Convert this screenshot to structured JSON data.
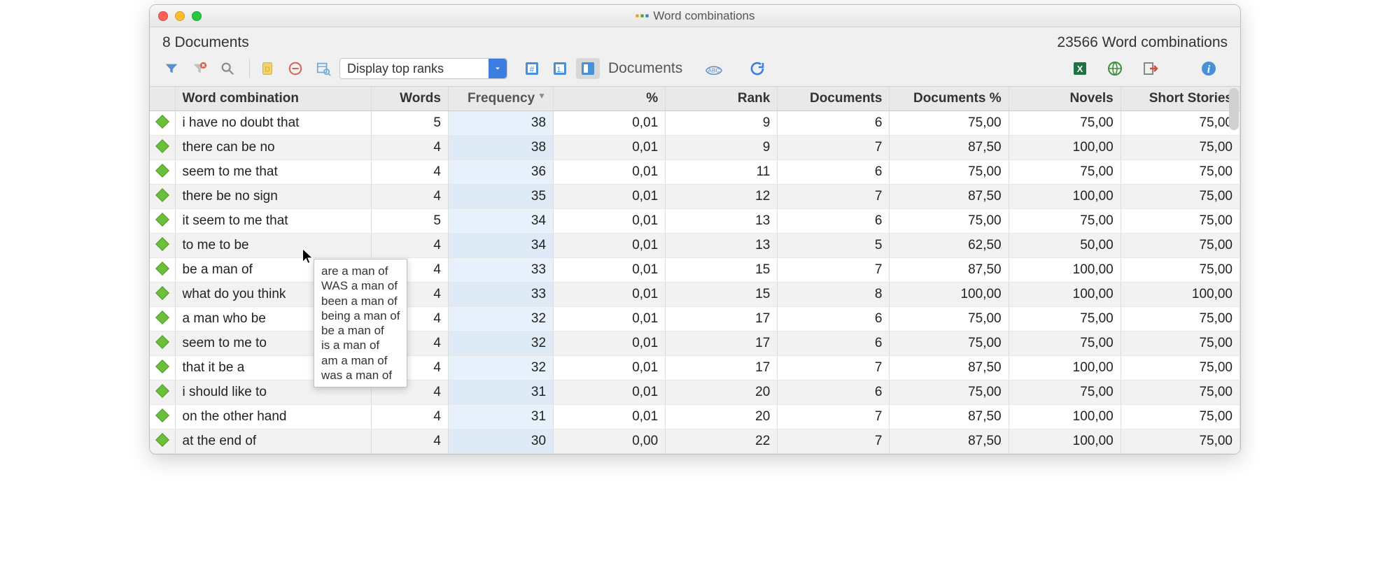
{
  "window": {
    "title": "Word combinations"
  },
  "info": {
    "left": "8 Documents",
    "right": "23566 Word combinations"
  },
  "toolbar": {
    "dropdown_label": "Display top ranks",
    "documents_label": "Documents"
  },
  "columns": {
    "mark": "",
    "combo": "Word combination",
    "words": "Words",
    "freq": "Frequency",
    "pct": "%",
    "rank": "Rank",
    "docs": "Documents",
    "docp": "Documents %",
    "novels": "Novels",
    "ss": "Short Stories"
  },
  "rows": [
    {
      "combo": "i have no doubt that",
      "words": "5",
      "freq": "38",
      "pct": "0,01",
      "rank": "9",
      "docs": "6",
      "docp": "75,00",
      "nov": "75,00",
      "ss": "75,00"
    },
    {
      "combo": "there can be no",
      "words": "4",
      "freq": "38",
      "pct": "0,01",
      "rank": "9",
      "docs": "7",
      "docp": "87,50",
      "nov": "100,00",
      "ss": "75,00"
    },
    {
      "combo": "seem to me that",
      "words": "4",
      "freq": "36",
      "pct": "0,01",
      "rank": "11",
      "docs": "6",
      "docp": "75,00",
      "nov": "75,00",
      "ss": "75,00"
    },
    {
      "combo": "there be no sign",
      "words": "4",
      "freq": "35",
      "pct": "0,01",
      "rank": "12",
      "docs": "7",
      "docp": "87,50",
      "nov": "100,00",
      "ss": "75,00"
    },
    {
      "combo": "it seem to me that",
      "words": "5",
      "freq": "34",
      "pct": "0,01",
      "rank": "13",
      "docs": "6",
      "docp": "75,00",
      "nov": "75,00",
      "ss": "75,00"
    },
    {
      "combo": "to me to be",
      "words": "4",
      "freq": "34",
      "pct": "0,01",
      "rank": "13",
      "docs": "5",
      "docp": "62,50",
      "nov": "50,00",
      "ss": "75,00"
    },
    {
      "combo": "be a man of",
      "words": "4",
      "freq": "33",
      "pct": "0,01",
      "rank": "15",
      "docs": "7",
      "docp": "87,50",
      "nov": "100,00",
      "ss": "75,00"
    },
    {
      "combo": "what do you think",
      "words": "4",
      "freq": "33",
      "pct": "0,01",
      "rank": "15",
      "docs": "8",
      "docp": "100,00",
      "nov": "100,00",
      "ss": "100,00"
    },
    {
      "combo": "a man who be",
      "words": "4",
      "freq": "32",
      "pct": "0,01",
      "rank": "17",
      "docs": "6",
      "docp": "75,00",
      "nov": "75,00",
      "ss": "75,00"
    },
    {
      "combo": "seem to me to",
      "words": "4",
      "freq": "32",
      "pct": "0,01",
      "rank": "17",
      "docs": "6",
      "docp": "75,00",
      "nov": "75,00",
      "ss": "75,00"
    },
    {
      "combo": "that it be a",
      "words": "4",
      "freq": "32",
      "pct": "0,01",
      "rank": "17",
      "docs": "7",
      "docp": "87,50",
      "nov": "100,00",
      "ss": "75,00"
    },
    {
      "combo": "i should like to",
      "words": "4",
      "freq": "31",
      "pct": "0,01",
      "rank": "20",
      "docs": "6",
      "docp": "75,00",
      "nov": "75,00",
      "ss": "75,00"
    },
    {
      "combo": "on the other hand",
      "words": "4",
      "freq": "31",
      "pct": "0,01",
      "rank": "20",
      "docs": "7",
      "docp": "87,50",
      "nov": "100,00",
      "ss": "75,00"
    },
    {
      "combo": "at the end of",
      "words": "4",
      "freq": "30",
      "pct": "0,00",
      "rank": "22",
      "docs": "7",
      "docp": "87,50",
      "nov": "100,00",
      "ss": "75,00"
    }
  ],
  "tooltip_lines": [
    "are a man of",
    "WAS a man of",
    "been a man of",
    "being a man of",
    "be a man of",
    "is a man of",
    "am a man of",
    "was a man of"
  ]
}
